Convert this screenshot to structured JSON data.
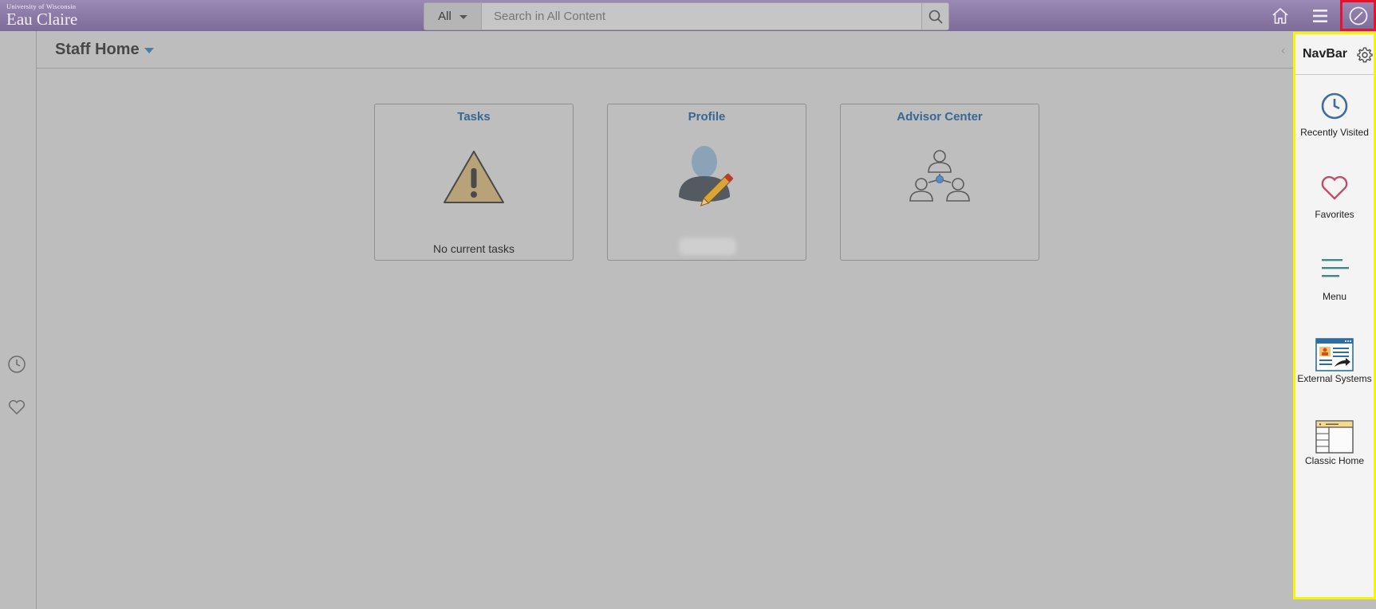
{
  "header": {
    "logo_small": "University of Wisconsin",
    "logo_big": "Eau Claire",
    "search_scope": "All",
    "search_placeholder": "Search in All Content",
    "icons": [
      "home-icon",
      "hamburger-menu-icon",
      "navbar-icon"
    ]
  },
  "page": {
    "title": "Staff Home"
  },
  "left_strip": {
    "icons": [
      "recently-visited-icon",
      "favorites-icon"
    ]
  },
  "tiles": [
    {
      "title": "Tasks",
      "footer": "No current tasks",
      "icon": "warning-icon"
    },
    {
      "title": "Profile",
      "footer": "",
      "icon": "profile-edit-icon"
    },
    {
      "title": "Advisor Center",
      "footer": "",
      "icon": "advisor-group-icon"
    }
  ],
  "navbar": {
    "title": "NavBar",
    "items": [
      {
        "label": "Recently Visited",
        "icon": "clock-icon"
      },
      {
        "label": "Favorites",
        "icon": "heart-icon"
      },
      {
        "label": "Menu",
        "icon": "menu-lines-icon"
      },
      {
        "label": "External Systems",
        "icon": "external-systems-icon"
      },
      {
        "label": "Classic Home",
        "icon": "classic-home-icon"
      }
    ]
  },
  "colors": {
    "header": "#8a77a6",
    "tile_title": "#3a6690",
    "navbar_highlight": "#f7f500",
    "navbar_button_highlight": "#e8102a"
  }
}
